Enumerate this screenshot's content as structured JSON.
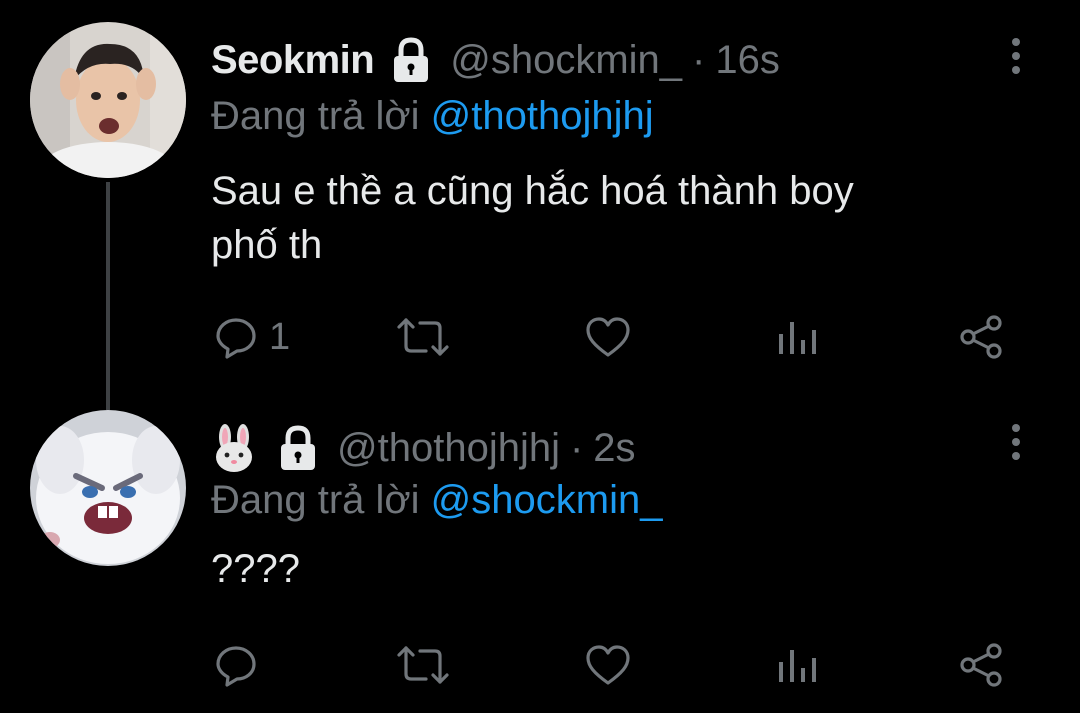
{
  "colors": {
    "background": "#000000",
    "text": "#e7e9ea",
    "muted": "#71767b",
    "mention": "#1d9bf0",
    "thread_line": "#3e4144"
  },
  "tweets": [
    {
      "display_name": "Seokmin",
      "protected_icon": "lock-icon",
      "handle": "@shockmin_",
      "separator": "·",
      "time": "16s",
      "reply_prefix": "Đang trả lời",
      "reply_to": "@thothojhjhj",
      "text_line1": "Sau e thề a cũng hắc hoá thành boy",
      "text_line2": "phố th",
      "reply_count": "1",
      "avatar": "person-avatar"
    },
    {
      "display_name_emoji": "rabbit-face-emoji",
      "protected_icon": "lock-icon",
      "handle": "@thothojhjhj",
      "separator": "·",
      "time": "2s",
      "reply_prefix": "Đang trả lời",
      "reply_to": "@shockmin_",
      "text_line1": "????",
      "reply_count": "",
      "avatar": "angry-rabbit-avatar"
    }
  ],
  "actions": [
    "reply-icon",
    "retweet-icon",
    "like-icon",
    "views-icon",
    "share-icon"
  ]
}
